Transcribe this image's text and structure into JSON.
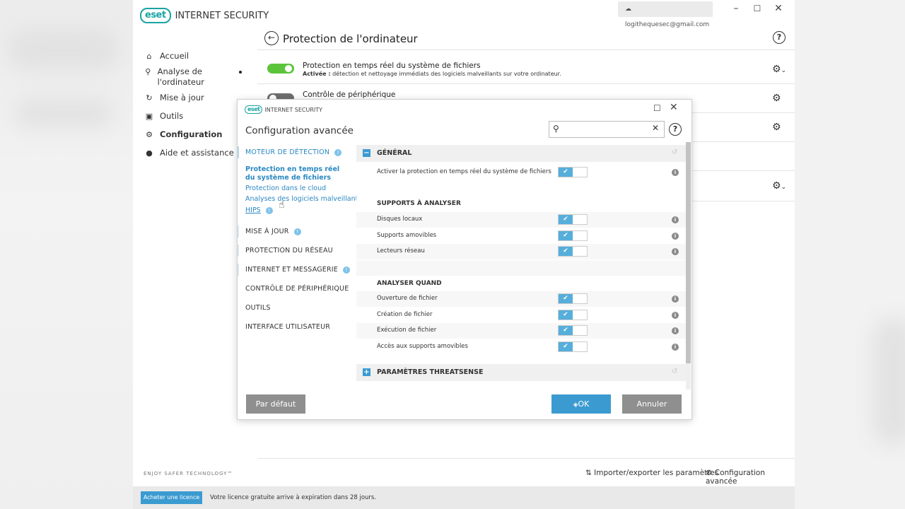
{
  "app": {
    "logo_badge": "eset",
    "product": "INTERNET SECURITY",
    "account": "logithequesec@gmail.com",
    "enjoy": "ENJOY SAFER TECHNOLOGY™"
  },
  "sidebar": {
    "items": [
      {
        "label": "Accueil",
        "icon": "home-icon"
      },
      {
        "label": "Analyse de l'ordinateur",
        "icon": "search-icon"
      },
      {
        "label": "Mise à jour",
        "icon": "refresh-icon"
      },
      {
        "label": "Outils",
        "icon": "briefcase-icon"
      },
      {
        "label": "Configuration",
        "icon": "gear-icon"
      },
      {
        "label": "Aide et assistance",
        "icon": "help-circle-icon"
      }
    ]
  },
  "page": {
    "title": "Protection de l'ordinateur",
    "rows": [
      {
        "title": "Protection en temps réel du système de fichiers",
        "status_bold": "Activée :",
        "status": " détection et nettoyage immédiats des logiciels malveillants sur votre ordinateur."
      },
      {
        "title": "Contrôle de périphérique"
      }
    ]
  },
  "footer": {
    "import_export": "Importer/exporter les paramètres",
    "advanced": "Configuration avancée",
    "buy": "Acheter une licence",
    "license_msg": "Votre licence gratuite arrive à expiration dans 28 jours."
  },
  "dialog": {
    "product": "INTERNET SECURITY",
    "title": "Configuration avancée",
    "search": {
      "value": "",
      "placeholder": ""
    },
    "categories": {
      "detection": "MOTEUR DE DÉTECTION",
      "update": "MISE À JOUR",
      "network": "PROTECTION DU RÉSEAU",
      "internet": "INTERNET ET MESSAGERIE",
      "device": "CONTRÔLE DE PÉRIPHÉRIQUE",
      "tools": "OUTILS",
      "ui": "INTERFACE UTILISATEUR"
    },
    "subitems": {
      "realtime": "Protection en temps réel du système de fichiers",
      "cloud": "Protection dans le cloud",
      "malware": "Analyses des logiciels malveillants",
      "hips": "HIPS"
    },
    "badge": "!",
    "general": {
      "title": "GÉNÉRAL",
      "enable": "Activer la protection en temps réel du système de fichiers"
    },
    "media": {
      "title": "SUPPORTS À ANALYSER",
      "local": "Disques locaux",
      "removable": "Supports amovibles",
      "network": "Lecteurs réseau"
    },
    "when": {
      "title": "ANALYSER QUAND",
      "open": "Ouverture de fichier",
      "create": "Création de fichier",
      "exec": "Exécution de fichier",
      "removable_access": "Accès aux supports amovibles"
    },
    "threatsense": {
      "title": "PARAMÈTRES THREATSENSE"
    },
    "buttons": {
      "default": "Par défaut",
      "ok": "OK",
      "cancel": "Annuler"
    }
  },
  "colors": {
    "accent": "#3b9bd1",
    "toggle_on": "#5cc43b",
    "brand": "#1aa3a3"
  }
}
